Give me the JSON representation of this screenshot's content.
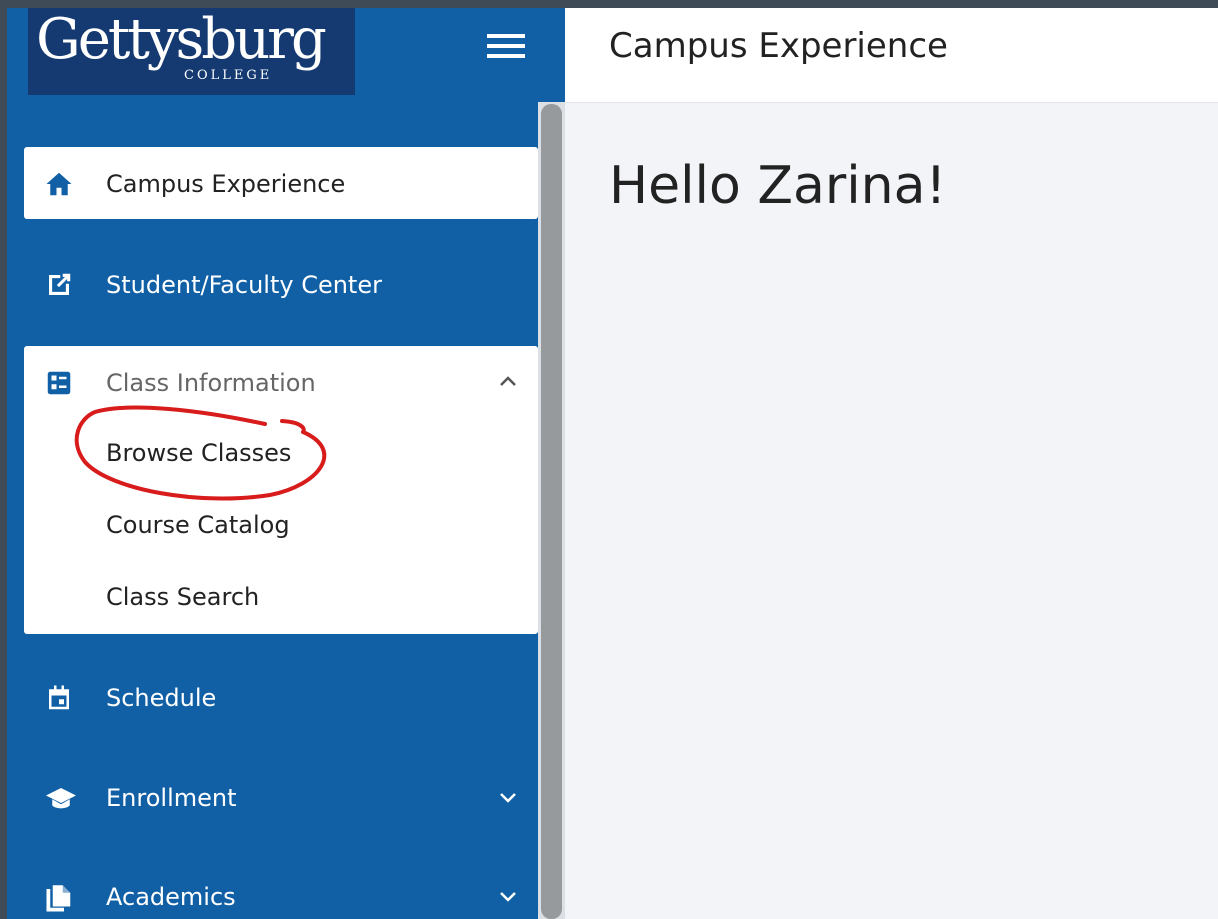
{
  "logo": {
    "name": "Gettysburg",
    "subtitle": "COLLEGE"
  },
  "header": {
    "title": "Campus Experience"
  },
  "main": {
    "greeting": "Hello Zarina!"
  },
  "sidebar": {
    "items": [
      {
        "label": "Campus Experience",
        "icon": "home-icon"
      },
      {
        "label": "Student/Faculty Center",
        "icon": "external-link-icon"
      },
      {
        "label": "Class Information",
        "icon": "dashboard-icon",
        "expanded": true,
        "children": [
          {
            "label": "Browse Classes"
          },
          {
            "label": "Course Catalog"
          },
          {
            "label": "Class Search"
          }
        ]
      },
      {
        "label": "Schedule",
        "icon": "calendar-icon"
      },
      {
        "label": "Enrollment",
        "icon": "graduation-cap-icon",
        "expandable": true
      },
      {
        "label": "Academics",
        "icon": "documents-icon",
        "expandable": true
      }
    ]
  },
  "colors": {
    "sidebar_bg": "#1160a6",
    "logo_bg": "#153a72",
    "annotation": "#d81b1b",
    "content_bg": "#f3f4f8"
  }
}
